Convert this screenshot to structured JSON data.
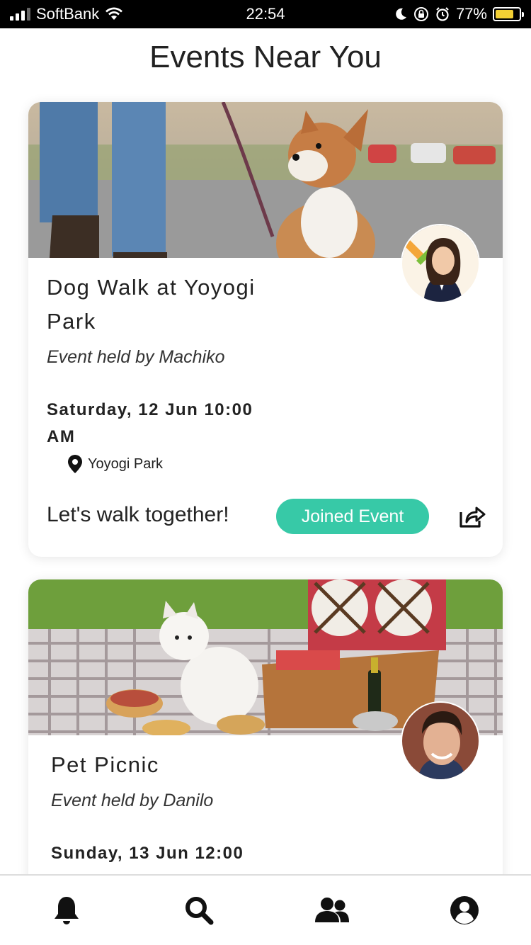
{
  "status_bar": {
    "carrier": "SoftBank",
    "time": "22:54",
    "battery": "77%"
  },
  "page": {
    "title": "Events Near You"
  },
  "events": [
    {
      "title": "Dog Walk at Yoyogi Park",
      "host": "Event held by Machiko",
      "datetime": "Saturday, 12 Jun 10:00 AM",
      "location": "Yoyogi Park",
      "tagline": "Let's walk together!",
      "button_label": "Joined Event"
    },
    {
      "title": "Pet Picnic",
      "host": "Event held by Danilo",
      "datetime": "Sunday, 13 Jun 12:00"
    }
  ],
  "colors": {
    "accent": "#37c9a7",
    "text": "#222222",
    "status_bar_bg": "#000000"
  },
  "nav_icons": [
    "bell-icon",
    "search-icon",
    "users-icon",
    "profile-icon"
  ]
}
